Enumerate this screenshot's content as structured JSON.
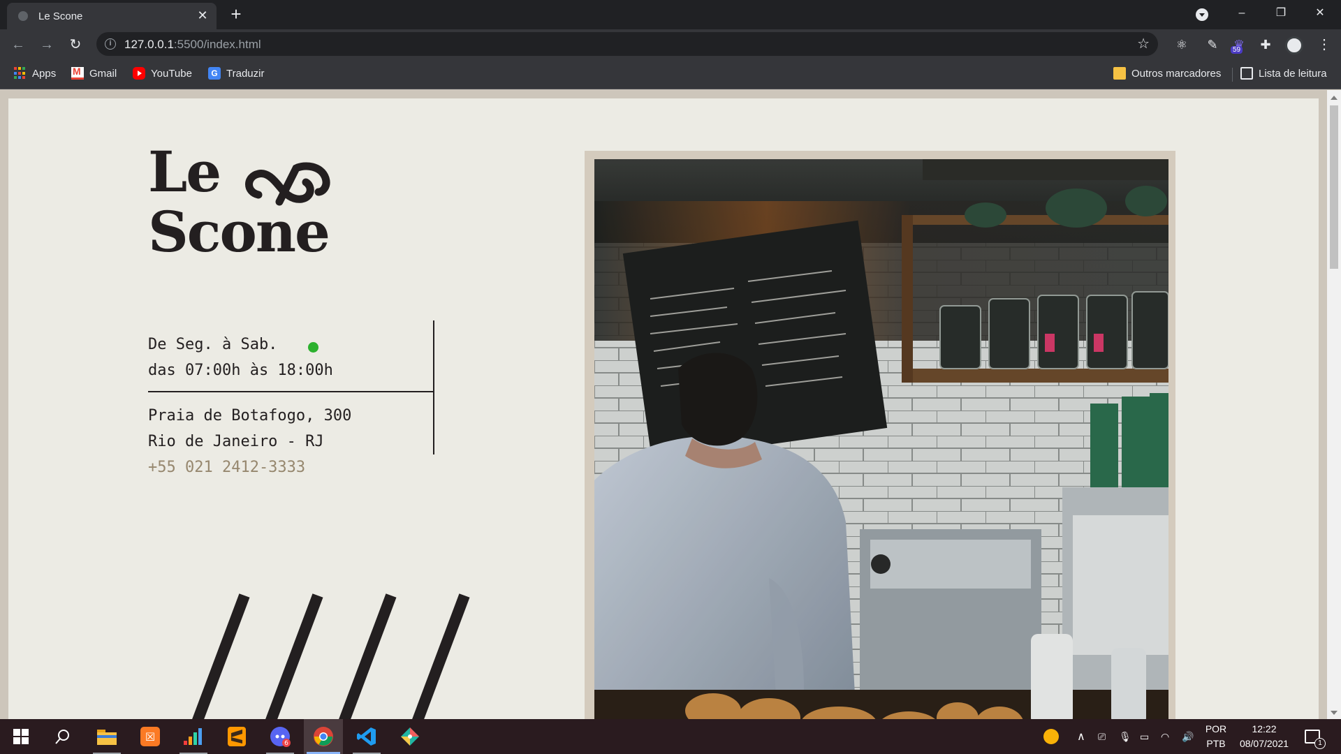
{
  "browser": {
    "tab_title": "Le Scone",
    "new_tab": "+",
    "url_host": "127.0.0.1",
    "url_path": ":5500/index.html",
    "minimize": "–",
    "restore": "❐",
    "close": "✕",
    "extension_badge": "59"
  },
  "bookmarks": {
    "apps": "Apps",
    "gmail": "Gmail",
    "youtube": "YouTube",
    "translate": "Traduzir",
    "other": "Outros marcadores",
    "reading_list": "Lista de leitura"
  },
  "page": {
    "logo_line1": "Le",
    "logo_line2": "Scone",
    "hours_line1": "De Seg. à Sab.",
    "hours_line2": "das 07:00h às 18:00h",
    "address_line1": "Praia de Botafogo, 300",
    "address_line2": "Rio de Janeiro - RJ",
    "phone": "+55 021 2412-3333",
    "colors": {
      "background": "#ecebe4",
      "text": "#231f20",
      "phone": "#96876e",
      "open_dot": "#2cb12e",
      "frame": "#d4cbbd"
    }
  },
  "taskbar": {
    "language_line1": "POR",
    "language_line2": "PTB",
    "time": "12:22",
    "date": "08/07/2021",
    "notification_count": "1",
    "discord_badge": "6",
    "apps": [
      "windows-start",
      "search",
      "file-explorer",
      "xampp",
      "deezer",
      "sublime-text",
      "discord",
      "chrome",
      "vscode",
      "git-kraken"
    ]
  }
}
